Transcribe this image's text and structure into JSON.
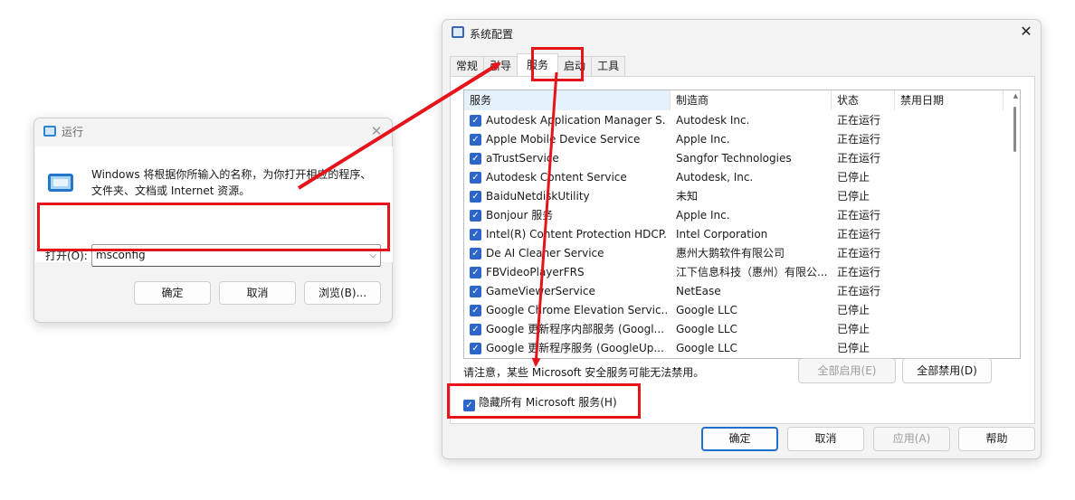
{
  "run_dialog": {
    "title": "运行",
    "description": "Windows 将根据你所输入的名称，为你打开相应的程序、文件夹、文档或 Internet 资源。",
    "open_label": "打开(O):",
    "open_value": "msconfig",
    "buttons": {
      "ok": "确定",
      "cancel": "取消",
      "browse": "浏览(B)..."
    }
  },
  "msconfig": {
    "title": "系统配置",
    "tabs": [
      "常规",
      "引导",
      "服务",
      "启动",
      "工具"
    ],
    "active_tab": "服务",
    "columns": [
      "服务",
      "制造商",
      "状态",
      "禁用日期"
    ],
    "services": [
      {
        "name": "Autodesk Application Manager S...",
        "manufacturer": "Autodesk Inc.",
        "status": "正在运行"
      },
      {
        "name": "Apple Mobile Device Service",
        "manufacturer": "Apple Inc.",
        "status": "正在运行"
      },
      {
        "name": "aTrustService",
        "manufacturer": "Sangfor Technologies",
        "status": "正在运行"
      },
      {
        "name": "Autodesk Content Service",
        "manufacturer": "Autodesk, Inc.",
        "status": "已停止"
      },
      {
        "name": "BaiduNetdiskUtility",
        "manufacturer": "未知",
        "status": "已停止"
      },
      {
        "name": "Bonjour 服务",
        "manufacturer": "Apple Inc.",
        "status": "正在运行"
      },
      {
        "name": "Intel(R) Content Protection HDCP...",
        "manufacturer": "Intel Corporation",
        "status": "正在运行"
      },
      {
        "name": "De AI Cleaner Service",
        "manufacturer": "惠州大鹅软件有限公司",
        "status": "正在运行"
      },
      {
        "name": "FBVideoPlayerFRS",
        "manufacturer": "江下信息科技（惠州）有限公...",
        "status": "正在运行"
      },
      {
        "name": "GameViewerService",
        "manufacturer": "NetEase",
        "status": "正在运行"
      },
      {
        "name": "Google Chrome Elevation Servic...",
        "manufacturer": "Google LLC",
        "status": "已停止"
      },
      {
        "name": "Google 更新程序内部服务 (Googl...",
        "manufacturer": "Google LLC",
        "status": "已停止"
      },
      {
        "name": "Google 更新程序服务 (GoogleUp...",
        "manufacturer": "Google LLC",
        "status": "已停止"
      }
    ],
    "note": "请注意，某些 Microsoft 安全服务可能无法禁用。",
    "enable_all": "全部启用(E)",
    "disable_all": "全部禁用(D)",
    "hide_ms_label": "隐藏所有 Microsoft 服务(H)",
    "hide_ms_checked": true,
    "buttons": {
      "ok": "确定",
      "cancel": "取消",
      "apply": "应用(A)",
      "help": "帮助"
    }
  },
  "colors": {
    "highlight": "#e5141b",
    "accent": "#2b66c8"
  }
}
